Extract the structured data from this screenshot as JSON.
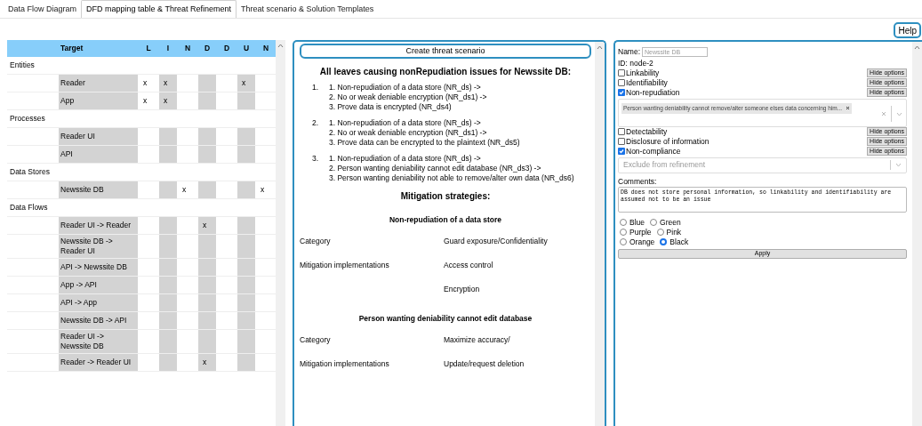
{
  "tabs": [
    {
      "label": "Data Flow Diagram",
      "selected": false
    },
    {
      "label": "DFD mapping table & Threat Refinement",
      "selected": true
    },
    {
      "label": "Threat scenario & Solution Templates",
      "selected": false
    }
  ],
  "help_button": "Help",
  "mapping_table": {
    "columns": [
      "Target",
      "L",
      "I",
      "N",
      "D",
      "D",
      "U",
      "N"
    ],
    "groups": [
      {
        "label": "Entities",
        "rows": [
          {
            "target": "Reader",
            "cells": [
              "x",
              "x",
              null,
              null,
              null,
              "x",
              null
            ]
          },
          {
            "target": "App",
            "cells": [
              "x",
              "x",
              null,
              null,
              null,
              null,
              null
            ]
          }
        ]
      },
      {
        "label": "Processes",
        "rows": [
          {
            "target": "Reader UI",
            "cells": [
              null,
              null,
              null,
              null,
              null,
              null,
              null
            ]
          },
          {
            "target": "API",
            "cells": [
              null,
              null,
              null,
              null,
              null,
              null,
              null
            ]
          }
        ]
      },
      {
        "label": "Data Stores",
        "rows": [
          {
            "target": "Newssite DB",
            "cells": [
              null,
              null,
              "x",
              null,
              null,
              null,
              "x"
            ]
          }
        ]
      },
      {
        "label": "Data Flows",
        "rows": [
          {
            "target": "Reader UI -> Reader",
            "cells": [
              null,
              null,
              null,
              "x",
              null,
              null,
              null
            ]
          },
          {
            "target": "Newssite DB -> Reader UI",
            "cells": [
              null,
              null,
              null,
              null,
              null,
              null,
              null
            ]
          },
          {
            "target": "API -> Newssite DB",
            "cells": [
              null,
              null,
              null,
              null,
              null,
              null,
              null
            ]
          },
          {
            "target": "App -> API",
            "cells": [
              null,
              null,
              null,
              null,
              null,
              null,
              null
            ]
          },
          {
            "target": "API -> App",
            "cells": [
              null,
              null,
              null,
              null,
              null,
              null,
              null
            ]
          },
          {
            "target": "Newssite DB -> API",
            "cells": [
              null,
              null,
              null,
              null,
              null,
              null,
              null
            ]
          },
          {
            "target": "Reader UI -> Newssite DB",
            "cells": [
              null,
              null,
              null,
              null,
              null,
              null,
              null
            ]
          },
          {
            "target": "Reader -> Reader UI",
            "cells": [
              null,
              null,
              null,
              "x",
              null,
              null,
              null
            ]
          }
        ]
      }
    ]
  },
  "scenario_panel": {
    "button": "Create threat scenario",
    "heading": "All leaves causing nonRepudiation issues for Newssite DB:",
    "leaves": [
      {
        "number": "1.",
        "lines": [
          "1. Non-repudiation of a data store (NR_ds) ->",
          "2. No or weak deniable encryption (NR_ds1) ->",
          "3. Prove data is encrypted (NR_ds4)"
        ]
      },
      {
        "number": "2.",
        "lines": [
          "1. Non-repudiation of a data store (NR_ds) ->",
          "2. No or weak deniable encryption (NR_ds1) ->",
          "3. Prove data can be encrypted to the plaintext (NR_ds5)"
        ]
      },
      {
        "number": "3.",
        "lines": [
          "1. Non-repudiation of a data store (NR_ds) ->",
          "2. Person wanting deniability cannot edit database (NR_ds3) ->",
          "3. Person wanting deniability not able to remove/alter own data (NR_ds6)"
        ]
      }
    ],
    "mitigation_heading": "Mitigation strategies:",
    "mitigations": [
      {
        "title": "Non-repudiation of a data store",
        "rows": [
          {
            "label": "Category",
            "value": "Guard exposure/Confidentiality"
          },
          {
            "label": "Mitigation implementations",
            "value": "Access control"
          },
          {
            "value": "Encryption"
          }
        ]
      },
      {
        "title": "Person wanting deniability cannot edit database",
        "rows": [
          {
            "label": "Category",
            "value": "Maximize accuracy/"
          },
          {
            "label": "Mitigation implementations",
            "value": "Update/request deletion"
          }
        ]
      }
    ]
  },
  "node_panel": {
    "name_label": "Name:",
    "name_placeholder": "Newssite DB",
    "id": "ID: node-2",
    "threats": [
      {
        "label": "Linkability",
        "checked": false,
        "button": "Hide options"
      },
      {
        "label": "Identifiability",
        "checked": false,
        "button": "Hide options"
      },
      {
        "label": "Non-repudiation",
        "checked": true,
        "button": "Hide options",
        "select": {
          "kind": "multi",
          "tags": [
            "Person wanting deniability cannot remove/alter someone elses data concerning him..."
          ]
        }
      },
      {
        "label": "Detectability",
        "checked": false,
        "button": "Hide options"
      },
      {
        "label": "Disclosure of information",
        "checked": false,
        "button": "Hide options"
      },
      {
        "label": "Non-compliance",
        "checked": true,
        "button": "Hide options",
        "select": {
          "kind": "single",
          "placeholder": "Exclude from refinement"
        }
      }
    ],
    "comments_label": "Comments:",
    "comments": "DB does not store personal information, so linkability and identifiability are assumed not to be an issue",
    "colors": [
      [
        {
          "label": "Blue",
          "selected": false
        },
        {
          "label": "Green",
          "selected": false
        }
      ],
      [
        {
          "label": "Purple",
          "selected": false
        },
        {
          "label": "Pink",
          "selected": false
        }
      ],
      [
        {
          "label": "Orange",
          "selected": false
        },
        {
          "label": "Black",
          "selected": true
        }
      ]
    ],
    "apply_button": "Apply"
  }
}
